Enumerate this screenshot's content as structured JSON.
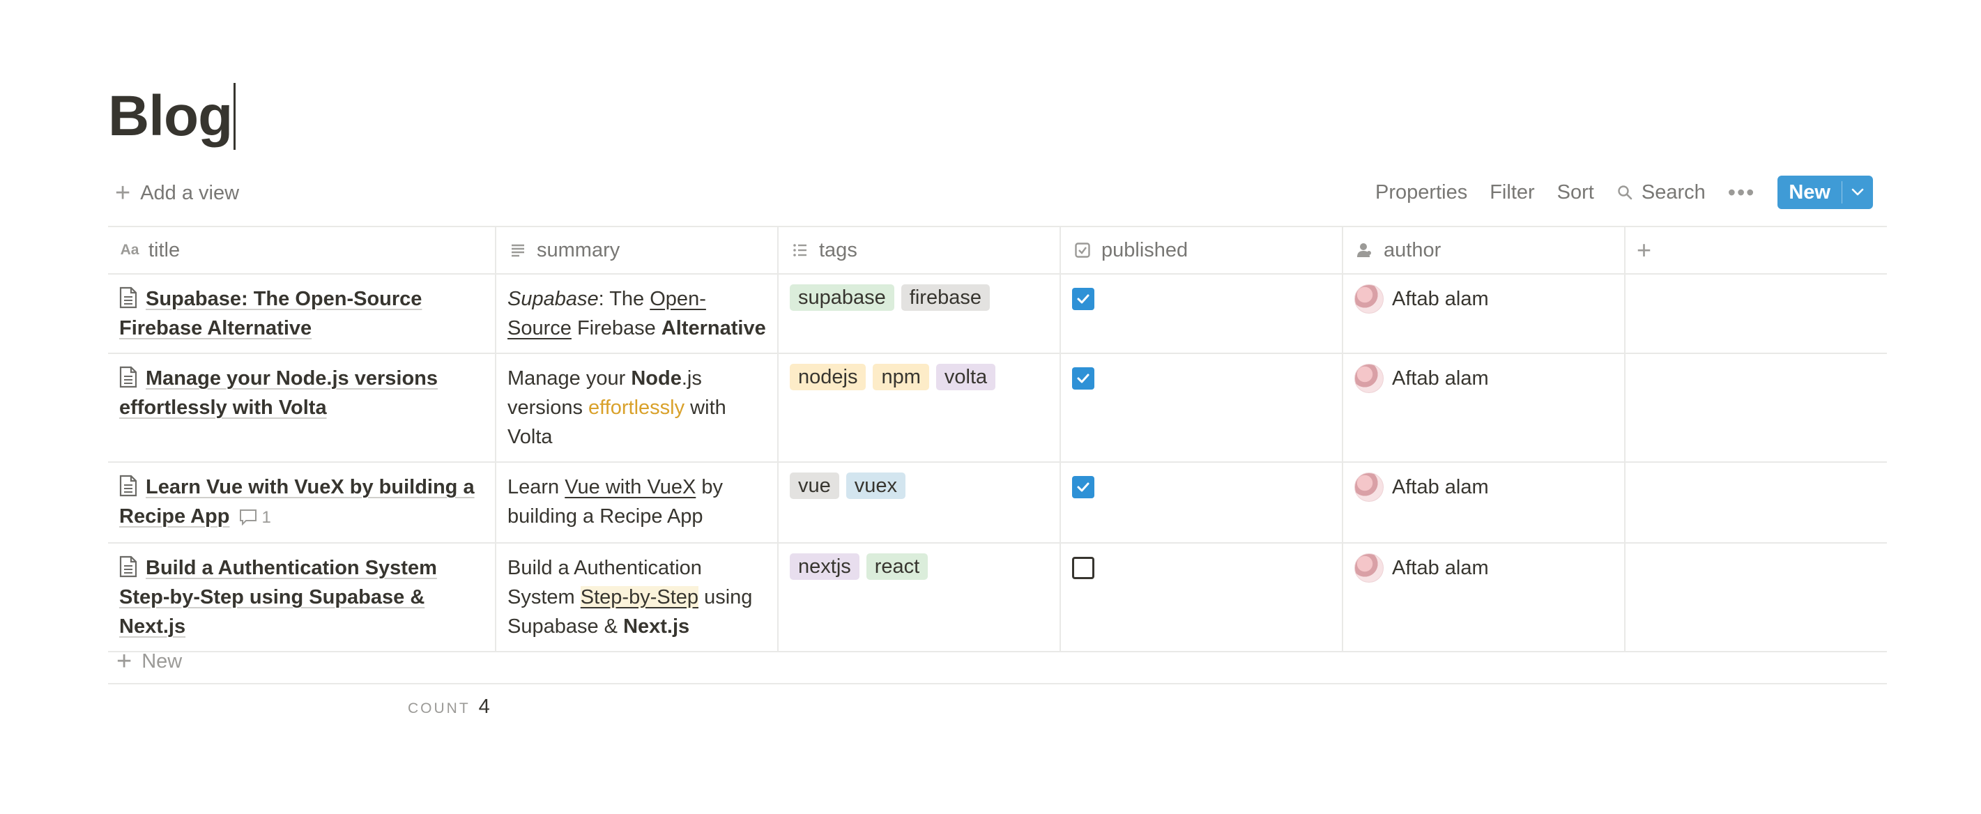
{
  "page": {
    "title": "Blog"
  },
  "toolbar": {
    "add_view": "Add a view",
    "properties": "Properties",
    "filter": "Filter",
    "sort": "Sort",
    "search": "Search",
    "new": "New"
  },
  "columns": {
    "title": "title",
    "summary": "summary",
    "tags": "tags",
    "published": "published",
    "author": "author"
  },
  "rows": [
    {
      "title": "Supabase: The Open-Source Firebase Alternative",
      "summary": {
        "s1": "Supabase",
        "s2": ": The ",
        "s3": "Open-Source",
        "s4": " Firebase ",
        "s5": "Alternative"
      },
      "tags": [
        "supabase",
        "firebase"
      ],
      "published": true,
      "author": "Aftab alam"
    },
    {
      "title": "Manage your Node.js versions effortlessly with Volta",
      "summary": {
        "s1": "Manage your ",
        "s2": "Node",
        "s3": ".js versions ",
        "s4": "effortlessly",
        "s5": " with Volta"
      },
      "tags": [
        "nodejs",
        "npm",
        "volta"
      ],
      "published": true,
      "author": "Aftab alam"
    },
    {
      "title": "Learn Vue with VueX by building a Recipe App",
      "comments": "1",
      "summary": {
        "s1": "Learn ",
        "s2": "Vue with VueX",
        "s3": " by building a Recipe App"
      },
      "tags": [
        "vue",
        "vuex"
      ],
      "published": true,
      "author": "Aftab alam"
    },
    {
      "title": "Build a Authentication System Step-by-Step using Supabase & Next.js",
      "summary": {
        "s1": "Build a Authentication System ",
        "s2": "Step-by-Step",
        "s3": " using Supabase & ",
        "s4": "Next.js"
      },
      "tags": [
        "nextjs",
        "react"
      ],
      "published": false,
      "author": "Aftab alam"
    }
  ],
  "tag_colors": {
    "supabase": "#dbeddb",
    "firebase": "#e3e2e0",
    "nodejs": "#fdecc8",
    "npm": "#fdecc8",
    "volta": "#e8deee",
    "vue": "#e3e2e0",
    "vuex": "#d3e5ef",
    "nextjs": "#e8deee",
    "react": "#dbeddb"
  },
  "footer": {
    "new_label": "New",
    "count_label": "COUNT",
    "count_value": "4"
  },
  "colors": {
    "accent": "#3f9bd6",
    "checkbox": "#2e91d6"
  }
}
